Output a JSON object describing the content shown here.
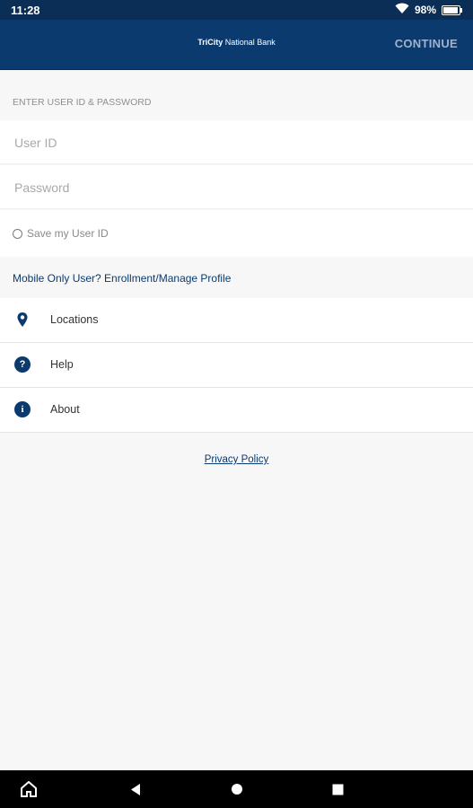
{
  "status_bar": {
    "time": "11:28",
    "battery_percent": "98%"
  },
  "app_bar": {
    "brand_bold": "TriCity",
    "brand_rest": " National Bank",
    "continue_label": "CONTINUE"
  },
  "login": {
    "section_title": "ENTER USER ID & PASSWORD",
    "user_id_placeholder": "User ID",
    "password_placeholder": "Password",
    "save_user_id_label": "Save my User ID"
  },
  "enrollment_link": "Mobile Only User? Enrollment/Manage Profile",
  "menu": {
    "items": [
      {
        "label": "Locations",
        "icon": "location-pin-icon"
      },
      {
        "label": "Help",
        "icon": "help-icon",
        "glyph": "?"
      },
      {
        "label": "About",
        "icon": "info-icon",
        "glyph": "i"
      }
    ]
  },
  "privacy_link": "Privacy Policy",
  "colors": {
    "brand_primary": "#0b3a6e",
    "continue_disabled": "#9fb3ca",
    "background": "#f7f7f7"
  }
}
